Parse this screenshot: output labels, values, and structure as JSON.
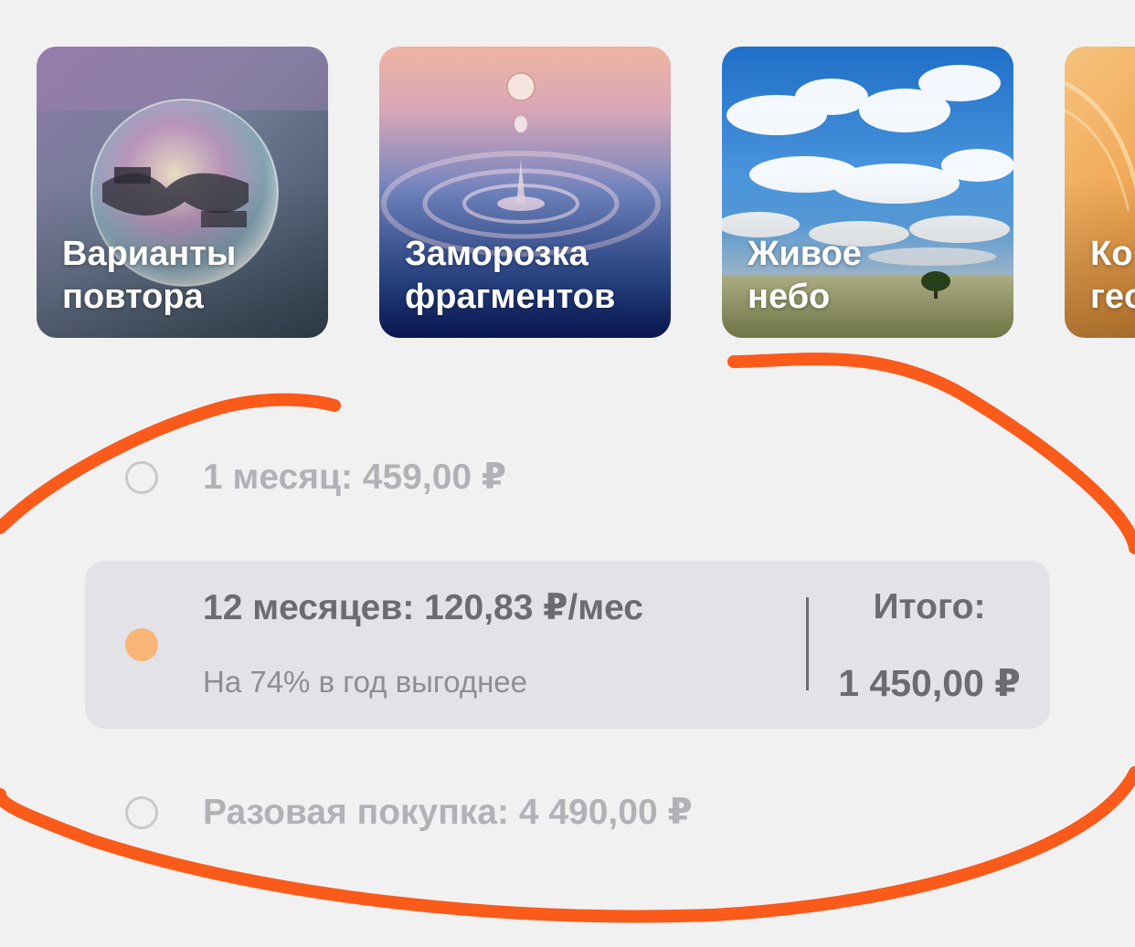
{
  "features": [
    {
      "line1": "Варианты",
      "line2": "повтора"
    },
    {
      "line1": "Заморозка",
      "line2": "фрагментов"
    },
    {
      "line1": "Живое",
      "line2": "небо"
    },
    {
      "line1": "Ко",
      "line2": "гео"
    }
  ],
  "plans": {
    "monthly": {
      "label": "1 месяц: 459,00 ₽"
    },
    "yearly": {
      "label": "12 месяцев: 120,83 ₽/мес",
      "subtitle": "На 74% в год выгоднее",
      "total_label": "Итого:",
      "total_value": "1 450,00 ₽"
    },
    "lifetime": {
      "label": "Разовая покупка: 4 490,00 ₽"
    }
  },
  "colors": {
    "background": "#f2f1f2",
    "accent": "#f8b577",
    "annotation": "#fa5a1a"
  }
}
